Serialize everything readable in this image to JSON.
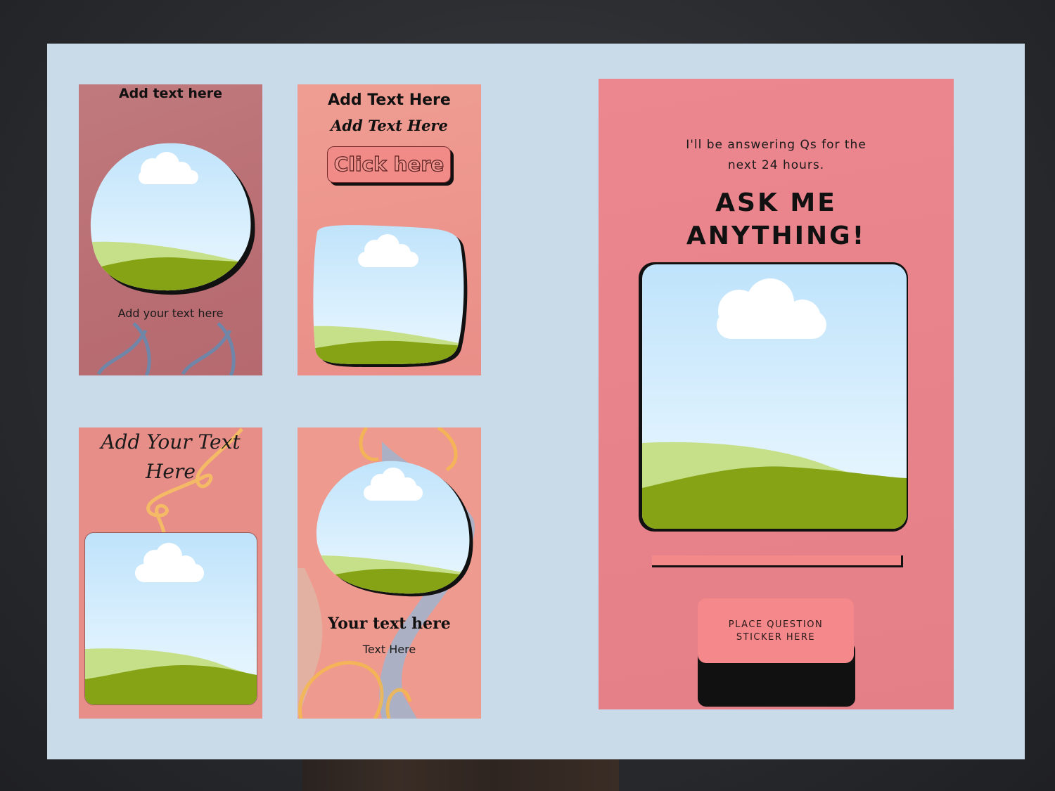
{
  "cards": {
    "card1": {
      "title": "Add text here",
      "body": "Add your text here"
    },
    "card2": {
      "title": "Add Text Here",
      "subtitle": "Add Text Here",
      "button_label": "Click here"
    },
    "card3": {
      "title_line1": "Add Your Text",
      "title_line2": "Here"
    },
    "card4": {
      "title": "Your text here",
      "body": "Text Here"
    },
    "card5": {
      "intro_line1": "I'll be answering Qs for the",
      "intro_line2": "next 24 hours.",
      "headline_line1": "ASK ME",
      "headline_line2": "ANYTHING!",
      "sticker_line1": "PLACE QUESTION",
      "sticker_line2": "STICKER HERE"
    }
  },
  "colors": {
    "board": "#c9dae8",
    "sky_top": "#bfe3fb",
    "sky_bottom": "#eef9ff",
    "hill_light": "#c6e08a",
    "hill_dark": "#86a316"
  }
}
